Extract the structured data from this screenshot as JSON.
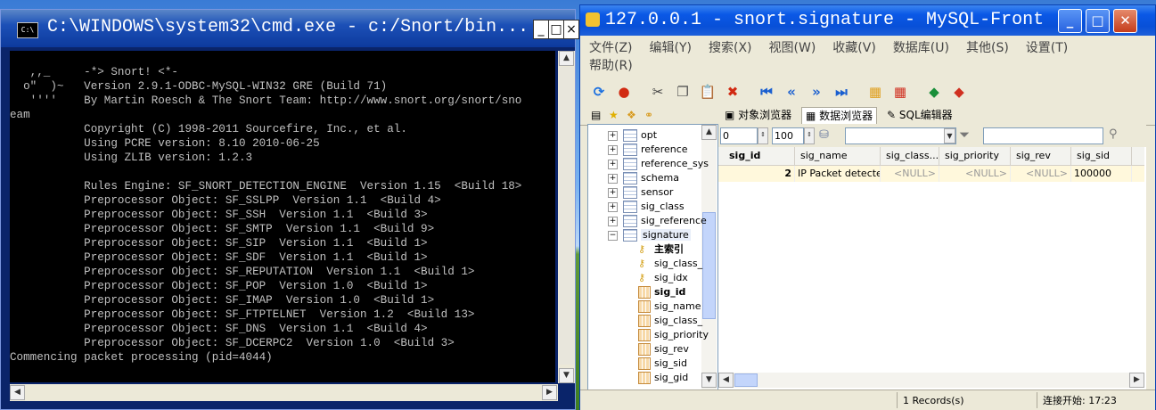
{
  "cmd": {
    "title": "C:\\WINDOWS\\system32\\cmd.exe - c:/Snort/bin...",
    "icon": "cmd-icon",
    "lines": [
      "",
      "   ,,_     -*> Snort! <*-",
      "  o\"  )~   Version 2.9.1-ODBC-MySQL-WIN32 GRE (Build 71)",
      "   ''''    By Martin Roesch & The Snort Team: http://www.snort.org/snort/sno",
      "eam",
      "           Copyright (C) 1998-2011 Sourcefire, Inc., et al.",
      "           Using PCRE version: 8.10 2010-06-25",
      "           Using ZLIB version: 1.2.3",
      "",
      "           Rules Engine: SF_SNORT_DETECTION_ENGINE  Version 1.15  <Build 18>",
      "           Preprocessor Object: SF_SSLPP  Version 1.1  <Build 4>",
      "           Preprocessor Object: SF_SSH  Version 1.1  <Build 3>",
      "           Preprocessor Object: SF_SMTP  Version 1.1  <Build 9>",
      "           Preprocessor Object: SF_SIP  Version 1.1  <Build 1>",
      "           Preprocessor Object: SF_SDF  Version 1.1  <Build 1>",
      "           Preprocessor Object: SF_REPUTATION  Version 1.1  <Build 1>",
      "           Preprocessor Object: SF_POP  Version 1.0  <Build 1>",
      "           Preprocessor Object: SF_IMAP  Version 1.0  <Build 1>",
      "           Preprocessor Object: SF_FTPTELNET  Version 1.2  <Build 13>",
      "           Preprocessor Object: SF_DNS  Version 1.1  <Build 4>",
      "           Preprocessor Object: SF_DCERPC2  Version 1.0  <Build 3>",
      "Commencing packet processing (pid=4044)"
    ],
    "buttons": {
      "minimize": "_",
      "maximize": "□",
      "close": "×"
    }
  },
  "mysql": {
    "title": "127.0.0.1 - snort.signature - MySQL-Front",
    "menu": [
      "文件(Z)",
      "编辑(Y)",
      "搜索(X)",
      "视图(W)",
      "收藏(V)",
      "数据库(U)",
      "其他(S)",
      "设置(T)",
      "帮助(R)"
    ],
    "toolbar_icons": [
      {
        "name": "refresh-icon",
        "glyph": "⟳",
        "color": "#1a6fe0"
      },
      {
        "name": "stop-icon",
        "glyph": "●",
        "color": "#d12a12"
      },
      {
        "name": "cut-icon",
        "glyph": "✂",
        "color": "#444"
      },
      {
        "name": "copy-icon",
        "glyph": "❐",
        "color": "#555"
      },
      {
        "name": "paste-icon",
        "glyph": "📋",
        "color": "#b07a2c"
      },
      {
        "name": "delete-icon",
        "glyph": "✖",
        "color": "#d12a12"
      },
      {
        "name": "first-icon",
        "glyph": "⏮",
        "color": "#1a5fd0"
      },
      {
        "name": "prev-icon",
        "glyph": "«",
        "color": "#1a5fd0"
      },
      {
        "name": "next-icon",
        "glyph": "»",
        "color": "#1a5fd0"
      },
      {
        "name": "last-icon",
        "glyph": "⏭",
        "color": "#1a5fd0"
      },
      {
        "name": "insert-record-icon",
        "glyph": "▦",
        "color": "#e0a020"
      },
      {
        "name": "delete-record-icon",
        "glyph": "▦",
        "color": "#d03020"
      },
      {
        "name": "post-icon",
        "glyph": "◆",
        "color": "#1a8f3a"
      },
      {
        "name": "cancel-icon",
        "glyph": "◆",
        "color": "#d03020"
      }
    ],
    "tabs": [
      "对象浏览器",
      "数据浏览器",
      "SQL编辑器"
    ],
    "active_tab": 1,
    "tree": {
      "tables": [
        "opt",
        "reference",
        "reference_sys",
        "schema",
        "sensor",
        "sig_class",
        "sig_reference",
        "signature"
      ],
      "signature_children": [
        {
          "label": "主索引",
          "type": "key",
          "bold": true
        },
        {
          "label": "sig_class_",
          "type": "key"
        },
        {
          "label": "sig_idx",
          "type": "key"
        },
        {
          "label": "sig_id",
          "type": "col",
          "bold": true
        },
        {
          "label": "sig_name",
          "type": "col"
        },
        {
          "label": "sig_class_",
          "type": "col"
        },
        {
          "label": "sig_priority",
          "type": "col"
        },
        {
          "label": "sig_rev",
          "type": "col"
        },
        {
          "label": "sig_sid",
          "type": "col"
        },
        {
          "label": "sig_gid",
          "type": "col"
        }
      ]
    },
    "filter": {
      "offset": "0",
      "limit": "100",
      "field_value": "",
      "search_value": ""
    },
    "grid": {
      "columns": [
        "sig_id",
        "sig_name",
        "sig_class...",
        "sig_priority",
        "sig_rev",
        "sig_sid"
      ],
      "rows": [
        [
          "2",
          "IP Packet detected",
          "<NULL>",
          "<NULL>",
          "<NULL>",
          "100000"
        ]
      ]
    },
    "status": {
      "records": "1 Records(s)",
      "connect": "连接开始: 17:23"
    }
  }
}
